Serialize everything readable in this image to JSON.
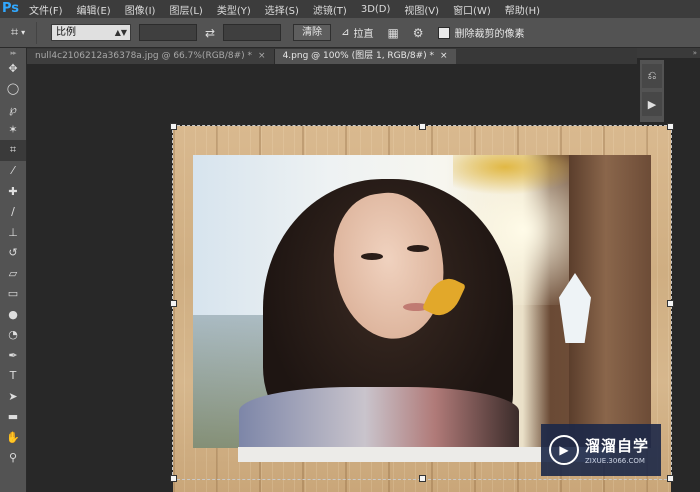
{
  "app": {
    "logo": "Ps"
  },
  "menu": [
    "文件(F)",
    "编辑(E)",
    "图像(I)",
    "图层(L)",
    "类型(Y)",
    "选择(S)",
    "滤镜(T)",
    "3D(D)",
    "视图(V)",
    "窗口(W)",
    "帮助(H)"
  ],
  "options": {
    "tool_icon": "crop-icon",
    "ratio_value": "比例",
    "clear_label": "清除",
    "straighten_label": "拉直",
    "delete_pixels_label": "删除裁剪的像素"
  },
  "tabs": [
    {
      "label": "null4c2106212a36378a.jpg @ 66.7%(RGB/8#) *",
      "close": "×",
      "active": false
    },
    {
      "label": "4.png @ 100% (图层 1, RGB/8#) *",
      "close": "×",
      "active": true
    }
  ],
  "tools": [
    "move-icon",
    "marquee-icon",
    "lasso-icon",
    "magic-wand-icon",
    "crop-icon",
    "eyedropper-icon",
    "healing-icon",
    "brush-icon",
    "stamp-icon",
    "history-brush-icon",
    "eraser-icon",
    "gradient-icon",
    "blur-icon",
    "dodge-icon",
    "pen-icon",
    "type-icon",
    "path-select-icon",
    "rectangle-icon",
    "hand-icon",
    "zoom-icon"
  ],
  "right_panel": {
    "collapse": "»"
  },
  "watermark": {
    "title": "溜溜自学",
    "url": "ZIXUE.3066.COM"
  },
  "colors": {
    "accent": "#31a8ff",
    "ui_bg": "#535353",
    "canvas_bg": "#282828"
  }
}
